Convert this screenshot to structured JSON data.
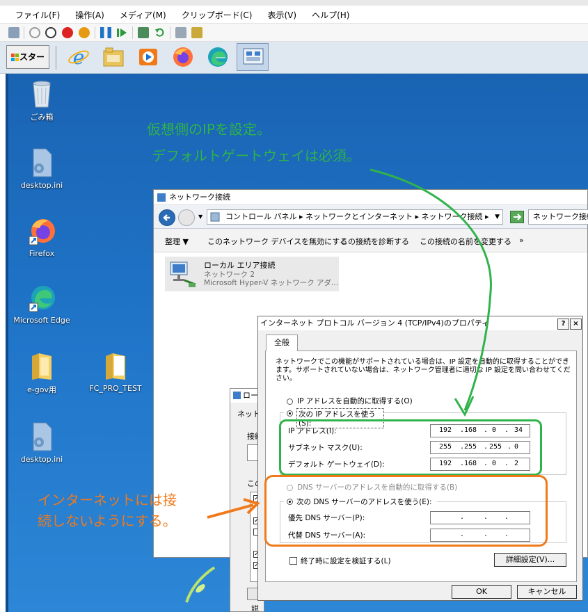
{
  "host": {
    "menu": [
      "ファイル(F)",
      "操作(A)",
      "メディア(M)",
      "クリップボード(C)",
      "表示(V)",
      "ヘルプ(H)"
    ]
  },
  "taskbar": {
    "start_label": "スタート"
  },
  "desktop": {
    "icons": [
      {
        "label": "ごみ箱"
      },
      {
        "label": "desktop.ini"
      },
      {
        "label": "Firefox"
      },
      {
        "label": "Microsoft Edge"
      },
      {
        "label": "e-gov用"
      },
      {
        "label": "FC_PRO_TEST"
      },
      {
        "label": "desktop.ini"
      }
    ]
  },
  "annotations": {
    "green_line1": "仮想側のIPを設定。",
    "green_line2": "デフォルトゲートウェイは必須。",
    "orange_line1": "インターネットには接",
    "orange_line2": "続しないようにする。",
    "colors": {
      "green": "#2fb34a",
      "orange": "#f07a1a"
    }
  },
  "netwin": {
    "title": "ネットワーク接続",
    "breadcrumb": [
      "コントロール パネル",
      "ネットワークとインターネット",
      "ネットワーク接続"
    ],
    "search_placeholder": "ネットワーク接続の",
    "commands": [
      "整理 ▼",
      "このネットワーク デバイスを無効にする",
      "この接続を診断する",
      "この接続の名前を変更する",
      "»"
    ],
    "adapter": {
      "name": "ローカル エリア接続",
      "network": "ネットワーク 2",
      "device": "Microsoft Hyper-V ネットワーク アダ..."
    }
  },
  "backdlg": {
    "title": "ロー",
    "tab": "ネット",
    "label1": "接続",
    "label2": "この",
    "desc": "説明"
  },
  "dialog": {
    "title": "インターネット プロトコル バージョン 4 (TCP/IPv4)のプロパティ",
    "help_btn": "?",
    "close_btn": "×",
    "tab": "全般",
    "description": "ネットワークでこの機能がサポートされている場合は、IP 設定を自動的に取得することができます。サポートされていない場合は、ネットワーク管理者に適切な IP 設定を問い合わせてください。",
    "ip_auto": "IP アドレスを自動的に取得する(O)",
    "ip_manual": "次の IP アドレスを使う(S):",
    "ip_label": "IP アドレス(I):",
    "ip_value": [
      "192",
      "168",
      "0",
      "34"
    ],
    "mask_label": "サブネット マスク(U):",
    "mask_value": [
      "255",
      "255",
      "255",
      "0"
    ],
    "gw_label": "デフォルト ゲートウェイ(D):",
    "gw_value": [
      "192",
      "168",
      "0",
      "2"
    ],
    "dns_auto": "DNS サーバーのアドレスを自動的に取得する(B)",
    "dns_manual": "次の DNS サーバーのアドレスを使う(E):",
    "dns_pref_label": "優先 DNS サーバー(P):",
    "dns_alt_label": "代替 DNS サーバー(A):",
    "validate": "終了時に設定を検証する(L)",
    "advanced": "詳細設定(V)...",
    "ok": "OK",
    "cancel": "キャンセル",
    "dot": "."
  }
}
